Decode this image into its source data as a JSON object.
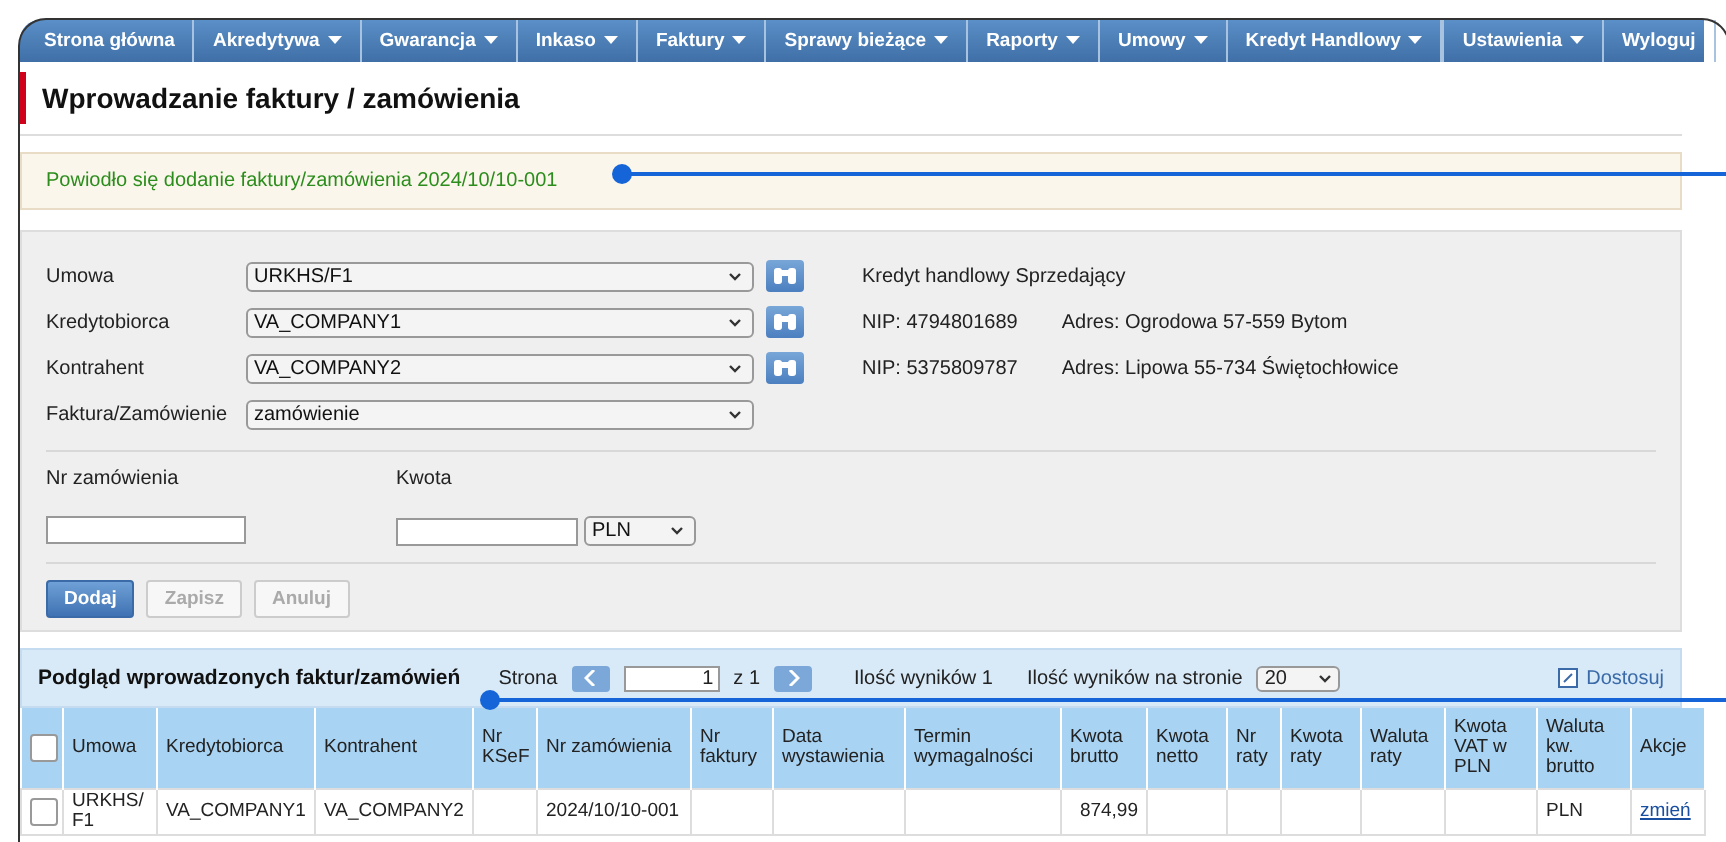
{
  "nav": [
    {
      "label": "Strona główna",
      "has_menu": false
    },
    {
      "label": "Akredytywa",
      "has_menu": true
    },
    {
      "label": "Gwarancja",
      "has_menu": true
    },
    {
      "label": "Inkaso",
      "has_menu": true
    },
    {
      "label": "Faktury",
      "has_menu": true
    },
    {
      "label": "Sprawy bieżące",
      "has_menu": true
    },
    {
      "label": "Raporty",
      "has_menu": true
    },
    {
      "label": "Umowy",
      "has_menu": true
    },
    {
      "label": "Kredyt Handlowy",
      "has_menu": true
    }
  ],
  "nav_right": [
    {
      "label": "Ustawienia",
      "has_menu": true
    },
    {
      "label": "Wyloguj",
      "has_menu": false
    }
  ],
  "page_title": "Wprowadzanie faktury / zamówienia",
  "message": "Powiodło się dodanie faktury/zamówienia 2024/10/10-001",
  "form": {
    "fields": [
      {
        "label": "Umowa",
        "value": "URKHS/F1",
        "lookup": true,
        "info": [
          "Kredyt handlowy Sprzedający"
        ]
      },
      {
        "label": "Kredytobiorca",
        "value": "VA_COMPANY1",
        "lookup": true,
        "info": [
          "NIP: 4794801689",
          "Adres: Ogrodowa 57-559 Bytom"
        ]
      },
      {
        "label": "Kontrahent",
        "value": "VA_COMPANY2",
        "lookup": true,
        "info": [
          "NIP: 5375809787",
          "Adres: Lipowa 55-734 Świętochłowice"
        ]
      },
      {
        "label": "Faktura/Zamówienie",
        "value": "zamówienie",
        "lookup": false
      }
    ],
    "order_number": {
      "label": "Nr zamówienia"
    },
    "amount": {
      "label": "Kwota",
      "currency": "PLN"
    },
    "buttons": [
      {
        "label": "Dodaj",
        "disabled": false
      },
      {
        "label": "Zapisz",
        "disabled": true
      },
      {
        "label": "Anuluj",
        "disabled": true
      }
    ]
  },
  "table": {
    "title": "Podgląd wprowadzonych faktur/zamówień",
    "pager": {
      "page_label": "Strona",
      "page": "1",
      "of": "z 1",
      "results": "Ilość wyników 1",
      "per_page_label": "Ilość wyników na stronie",
      "per_page": "20",
      "customize": "Dostosuj"
    },
    "columns": [
      "Umowa",
      "Kredytobiorca",
      "Kontrahent",
      "Nr KSeF",
      "Nr zamówienia",
      "Nr faktury",
      "Data wystawienia",
      "Termin wymagalności",
      "Kwota brutto",
      "Kwota netto",
      "Nr raty",
      "Kwota raty",
      "Waluta raty",
      "Kwota VAT w PLN",
      "Waluta kw. brutto",
      "Akcje"
    ],
    "all_checked": false,
    "rows": [
      {
        "checked": false,
        "cells": [
          "URKHS/ F1",
          "VA_COMPANY1",
          "VA_COMPANY2",
          "",
          "2024/10/10-001",
          "",
          "",
          "",
          "874,99",
          "",
          "",
          "",
          "",
          "",
          "PLN"
        ],
        "action": "zmień"
      }
    ]
  }
}
